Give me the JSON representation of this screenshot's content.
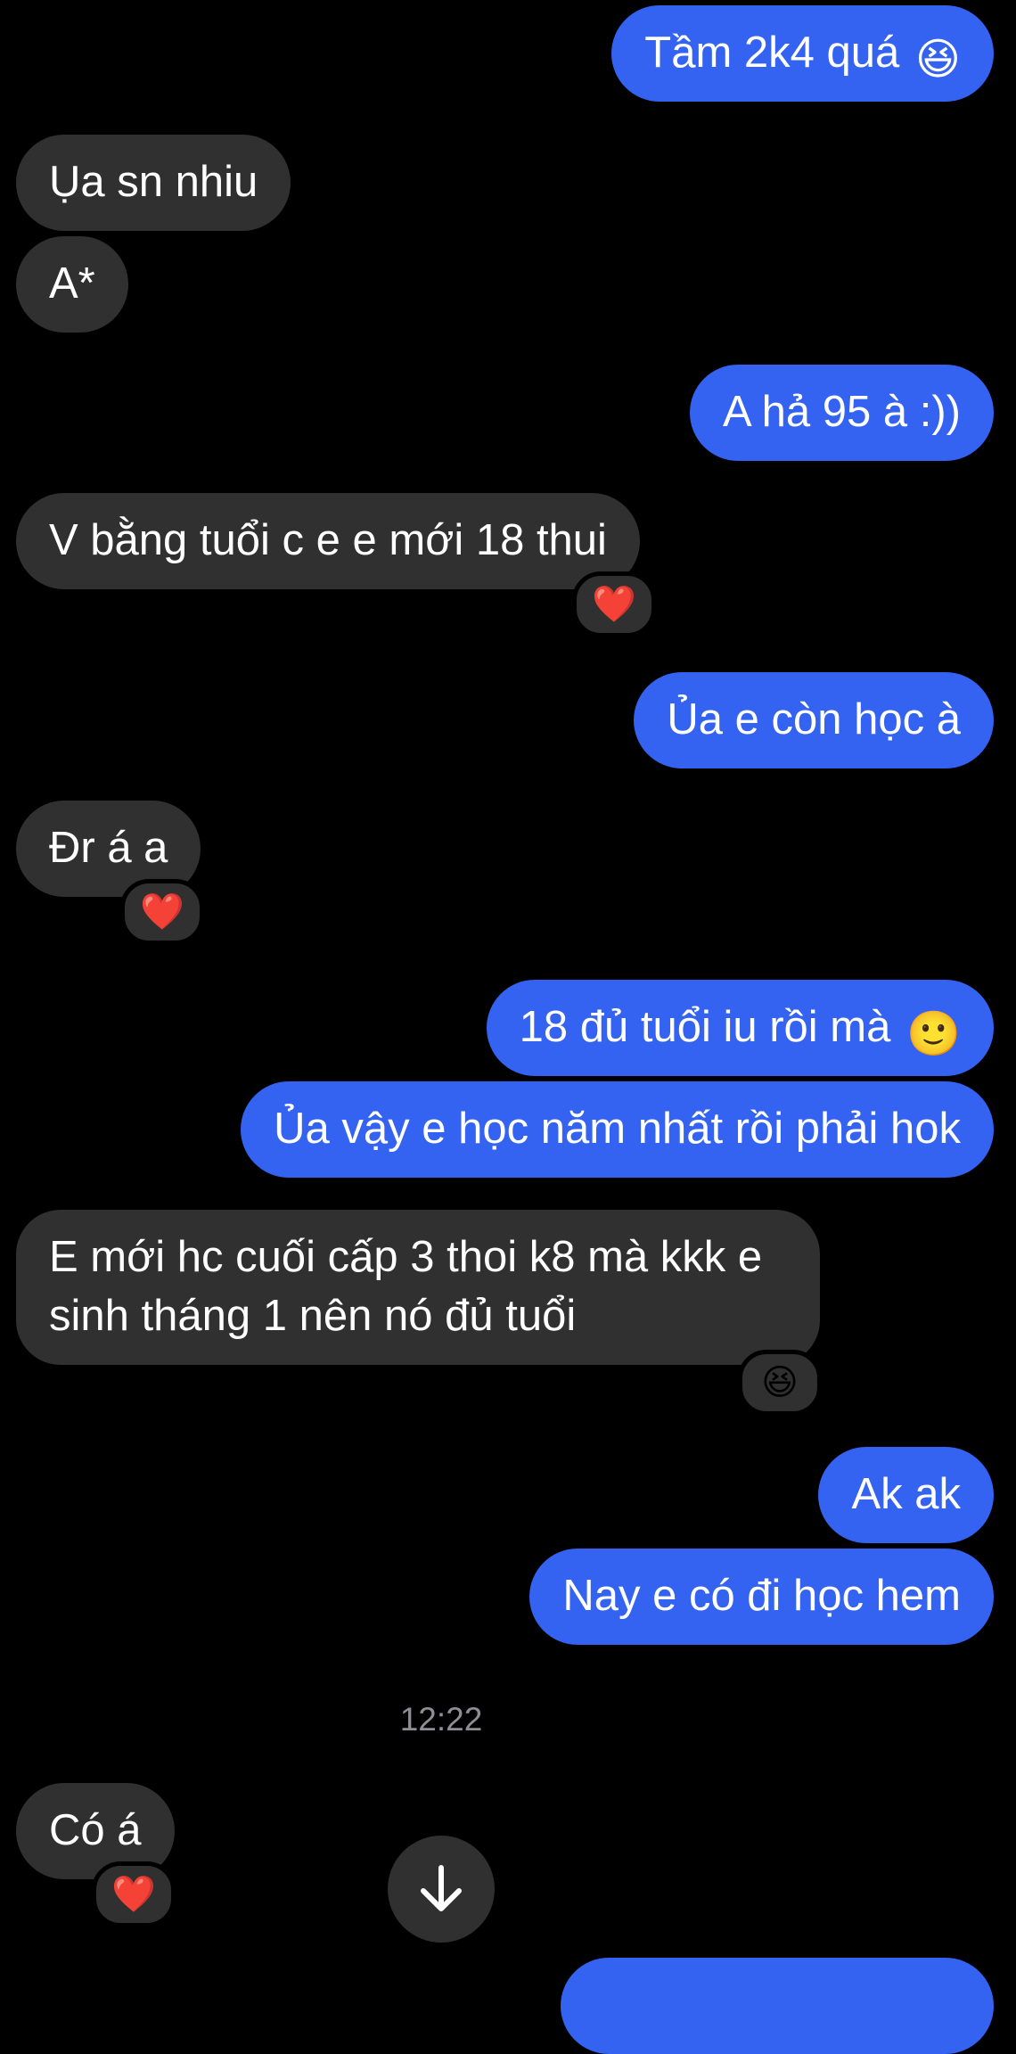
{
  "messages": [
    {
      "side": "out",
      "text": "Tầm 2k4 quá",
      "emoji": "😆"
    },
    {
      "side": "in",
      "text": "Ụa sn nhiu"
    },
    {
      "side": "in",
      "text": "A*"
    },
    {
      "side": "out",
      "text": "A hả 95 à :))"
    },
    {
      "side": "in",
      "text": "V bằng tuổi c e e mới 18 thui",
      "reaction": "❤️"
    },
    {
      "side": "out",
      "text": "Ủa e còn học à"
    },
    {
      "side": "in",
      "text": "Đr á a",
      "reaction": "❤️"
    },
    {
      "side": "out",
      "text": "18 đủ tuổi iu rồi mà",
      "emoji": "🙂"
    },
    {
      "side": "out",
      "text": "Ủa vậy e học năm nhất rồi phải hok"
    },
    {
      "side": "in",
      "text": "E mới hc cuối cấp 3 thoi k8 mà kkk e sinh tháng 1 nên nó đủ tuổi",
      "reaction": "😆"
    },
    {
      "side": "out",
      "text": "Ak ak"
    },
    {
      "side": "out",
      "text": "Nay e có đi học hem"
    },
    {
      "side": "in",
      "text": "Có á",
      "reaction": "❤️"
    }
  ],
  "timestamp": "12:22",
  "colors": {
    "background": "#000000",
    "incoming_bubble": "#303030",
    "outgoing_bubble": "#3363f0",
    "text": "#ffffff",
    "timestamp": "#8e8e93"
  },
  "icons": {
    "scroll_down": "arrow-down-icon"
  }
}
